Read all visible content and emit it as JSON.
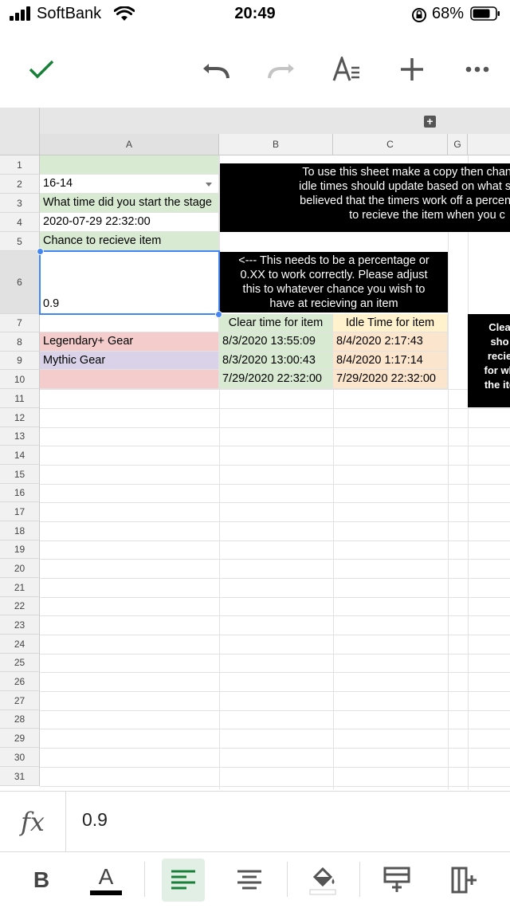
{
  "status_bar": {
    "carrier": "SoftBank",
    "time": "20:49",
    "battery": "68%"
  },
  "toolbar": {
    "icons": [
      "check-icon",
      "undo-icon",
      "redo-icon",
      "text-format-icon",
      "insert-plus-icon",
      "more-icon"
    ]
  },
  "sheet": {
    "columns": [
      "A",
      "B",
      "C",
      "G"
    ],
    "rows": [
      "1",
      "2",
      "3",
      "4",
      "5",
      "6",
      "7",
      "8",
      "9",
      "10",
      "11",
      "12",
      "13",
      "14",
      "15",
      "16",
      "17",
      "18",
      "19",
      "20",
      "21",
      "22",
      "23",
      "24",
      "25",
      "26",
      "27",
      "28",
      "29",
      "30",
      "31"
    ],
    "cells": {
      "a2": "16-14",
      "a3": "What time did you start the stage",
      "a4": "2020-07-29 22:32:00",
      "a5": "Chance to recieve item",
      "a6": "0.9",
      "a8": "Legendary+ Gear",
      "a9": "Mythic Gear",
      "b7": "Clear time for item",
      "c7": "Idle Time for item",
      "b8": "8/3/2020 13:55:09",
      "c8": "8/4/2020 2:17:43",
      "b9": "8/3/2020 13:00:43",
      "c9": "8/4/2020 1:17:14",
      "b10": "7/29/2020 22:32:00",
      "c10": "7/29/2020 22:32:00"
    },
    "note_top": [
      "To use this sheet make a copy then change what",
      "idle times should update based on what stage you",
      "believed that the timers work off a percentage sca",
      "to recieve the item when you c"
    ],
    "note_middle": [
      "<--- This needs to be a percentage or",
      "0.XX to work correctly. Please adjust",
      "this to whatever chance you wish to",
      "have at recieving an item"
    ],
    "note_right": [
      "Clea",
      "sho",
      "recie",
      "for wh",
      "the ite"
    ]
  },
  "formula_bar": {
    "label": "fx",
    "value": "0.9"
  },
  "format_bar": {
    "bold_label": "B",
    "text_color_label": "A",
    "text_color": "#000000",
    "accent": "#188038"
  }
}
